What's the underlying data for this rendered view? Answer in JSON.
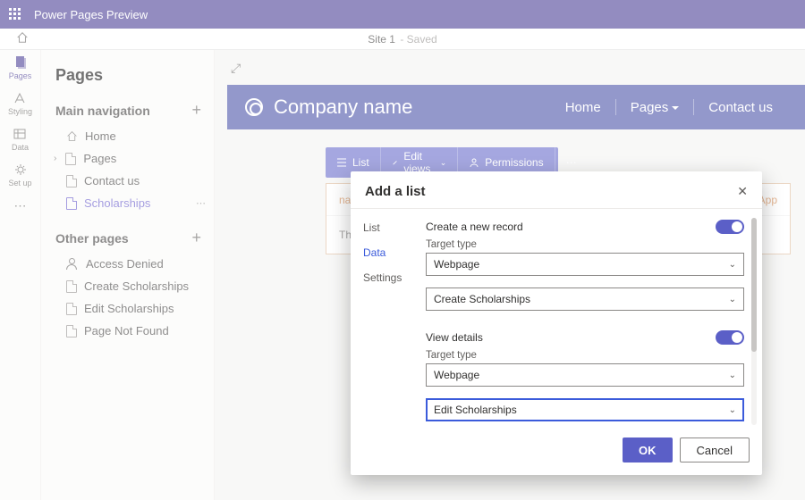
{
  "app": {
    "title": "Power Pages Preview"
  },
  "status": {
    "site": "Site 1",
    "state": "Saved"
  },
  "rail": {
    "items": [
      {
        "label": "Pages"
      },
      {
        "label": "Styling"
      },
      {
        "label": "Data"
      },
      {
        "label": "Set up"
      }
    ]
  },
  "pages_panel": {
    "title": "Pages",
    "main_nav_label": "Main navigation",
    "other_label": "Other pages",
    "main": [
      {
        "label": "Home"
      },
      {
        "label": "Pages"
      },
      {
        "label": "Contact us"
      },
      {
        "label": "Scholarships"
      }
    ],
    "other": [
      {
        "label": "Access Denied"
      },
      {
        "label": "Create Scholarships"
      },
      {
        "label": "Edit Scholarships"
      },
      {
        "label": "Page Not Found"
      }
    ]
  },
  "site_header": {
    "company": "Company name",
    "nav": {
      "home": "Home",
      "pages": "Pages",
      "contact": "Contact us"
    }
  },
  "toolbar": {
    "list": "List",
    "edit_views": "Edit views",
    "permissions": "Permissions"
  },
  "list_box": {
    "col_name": "name",
    "col_app": "App",
    "empty": "There "
  },
  "modal": {
    "title": "Add a list",
    "tabs": {
      "list": "List",
      "data": "Data",
      "settings": "Settings"
    },
    "create_label": "Create a new record",
    "target_type_label": "Target type",
    "target_type_value": "Webpage",
    "page_value_1": "Create Scholarships",
    "view_label": "View details",
    "page_value_2": "Edit Scholarships",
    "ok": "OK",
    "cancel": "Cancel"
  }
}
